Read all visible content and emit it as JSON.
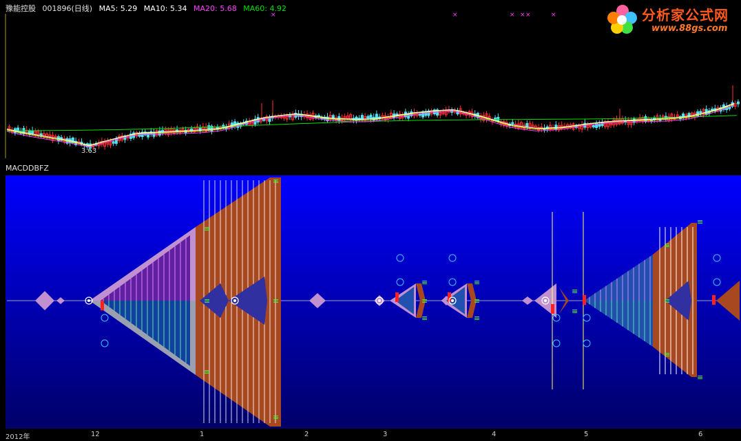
{
  "header": {
    "stock_name": "豫能控股",
    "stock_code": "001896(日线)",
    "ma5": "MA5: 5.29",
    "ma10": "MA10: 5.34",
    "ma20": "MA20: 5.68",
    "ma60": "MA60: 4.92"
  },
  "colors": {
    "ma5": "#ffffff",
    "ma10": "#ffff00",
    "ma20": "#ff40ff",
    "ma60": "#00e000",
    "up_candle": "#ff3030",
    "down_candle": "#50e0f0",
    "panel_top": "#0000ff",
    "panel_bottom": "#000070",
    "lilac": "#c090d0",
    "brown": "#a84820",
    "cyan_circle": "#40c0ff",
    "green_marks": "#40ff40"
  },
  "price_panel": {
    "low_label": "3.63"
  },
  "indicator_panel": {
    "name": "MACDDBFZ"
  },
  "logo": {
    "name": "分析家公式网",
    "url": "www.88gs.com"
  },
  "x_axis": {
    "labels": [
      "2012年",
      "12",
      "1",
      "2",
      "3",
      "4",
      "5",
      "6"
    ]
  }
}
